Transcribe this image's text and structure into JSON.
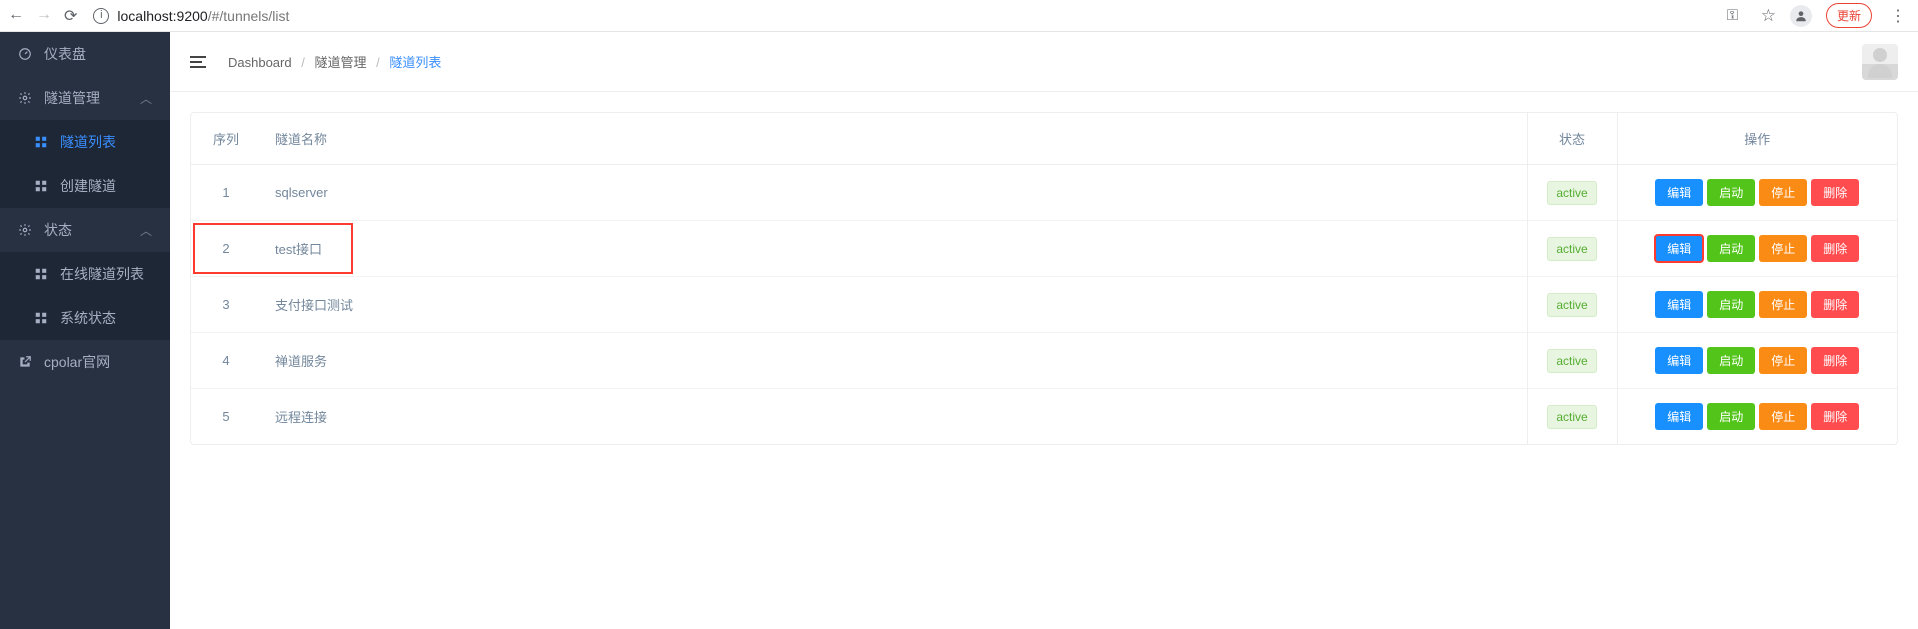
{
  "browser": {
    "url_host": "localhost:9200",
    "url_path": "/#/tunnels/list",
    "update_label": "更新"
  },
  "sidebar": {
    "items": [
      {
        "label": "仪表盘"
      },
      {
        "label": "隧道管理"
      },
      {
        "label": "隧道列表"
      },
      {
        "label": "创建隧道"
      },
      {
        "label": "状态"
      },
      {
        "label": "在线隧道列表"
      },
      {
        "label": "系统状态"
      },
      {
        "label": "cpolar官网"
      }
    ]
  },
  "breadcrumb": {
    "items": [
      "Dashboard",
      "隧道管理",
      "隧道列表"
    ]
  },
  "table": {
    "headers": {
      "index": "序列",
      "name": "隧道名称",
      "status": "状态",
      "actions": "操作"
    },
    "status_label": "active",
    "action_labels": {
      "edit": "编辑",
      "start": "启动",
      "stop": "停止",
      "delete": "删除"
    },
    "rows": [
      {
        "index": "1",
        "name": "sqlserver"
      },
      {
        "index": "2",
        "name": "test接口"
      },
      {
        "index": "3",
        "name": "支付接口测试"
      },
      {
        "index": "4",
        "name": "禅道服务"
      },
      {
        "index": "5",
        "name": "远程连接"
      }
    ]
  }
}
